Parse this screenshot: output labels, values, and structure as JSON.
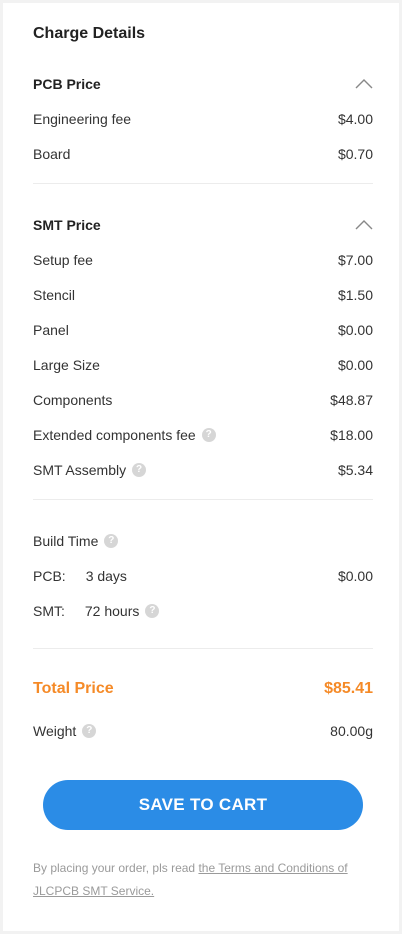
{
  "title": "Charge Details",
  "pcb": {
    "heading": "PCB Price",
    "rows": [
      {
        "label": "Engineering fee",
        "value": "$4.00"
      },
      {
        "label": "Board",
        "value": "$0.70"
      }
    ]
  },
  "smt": {
    "heading": "SMT Price",
    "rows": [
      {
        "label": "Setup fee",
        "value": "$7.00"
      },
      {
        "label": "Stencil",
        "value": "$1.50"
      },
      {
        "label": "Panel",
        "value": "$0.00"
      },
      {
        "label": "Large Size",
        "value": "$0.00"
      },
      {
        "label": "Components",
        "value": "$48.87"
      },
      {
        "label": "Extended components fee",
        "value": "$18.00"
      },
      {
        "label": "SMT Assembly",
        "value": "$5.34"
      }
    ]
  },
  "build": {
    "label": "Build Time",
    "pcb_label": "PCB:",
    "pcb_time": "3 days",
    "pcb_value": "$0.00",
    "smt_label": "SMT:",
    "smt_time": "72 hours"
  },
  "total": {
    "label": "Total Price",
    "value": "$85.41"
  },
  "weight": {
    "label": "Weight",
    "value": "80.00g"
  },
  "cart_button": "SAVE TO CART",
  "note": {
    "prefix": "By placing your order, pls read",
    "link": "the Terms and Conditions of JLCPCB SMT Service."
  },
  "colors": {
    "accent": "#2b8ce6",
    "total": "#f58a27",
    "help_icon": "#d6d6d6"
  },
  "icons": {
    "collapse": "chevron-up-icon",
    "help": "question-circle-icon"
  }
}
